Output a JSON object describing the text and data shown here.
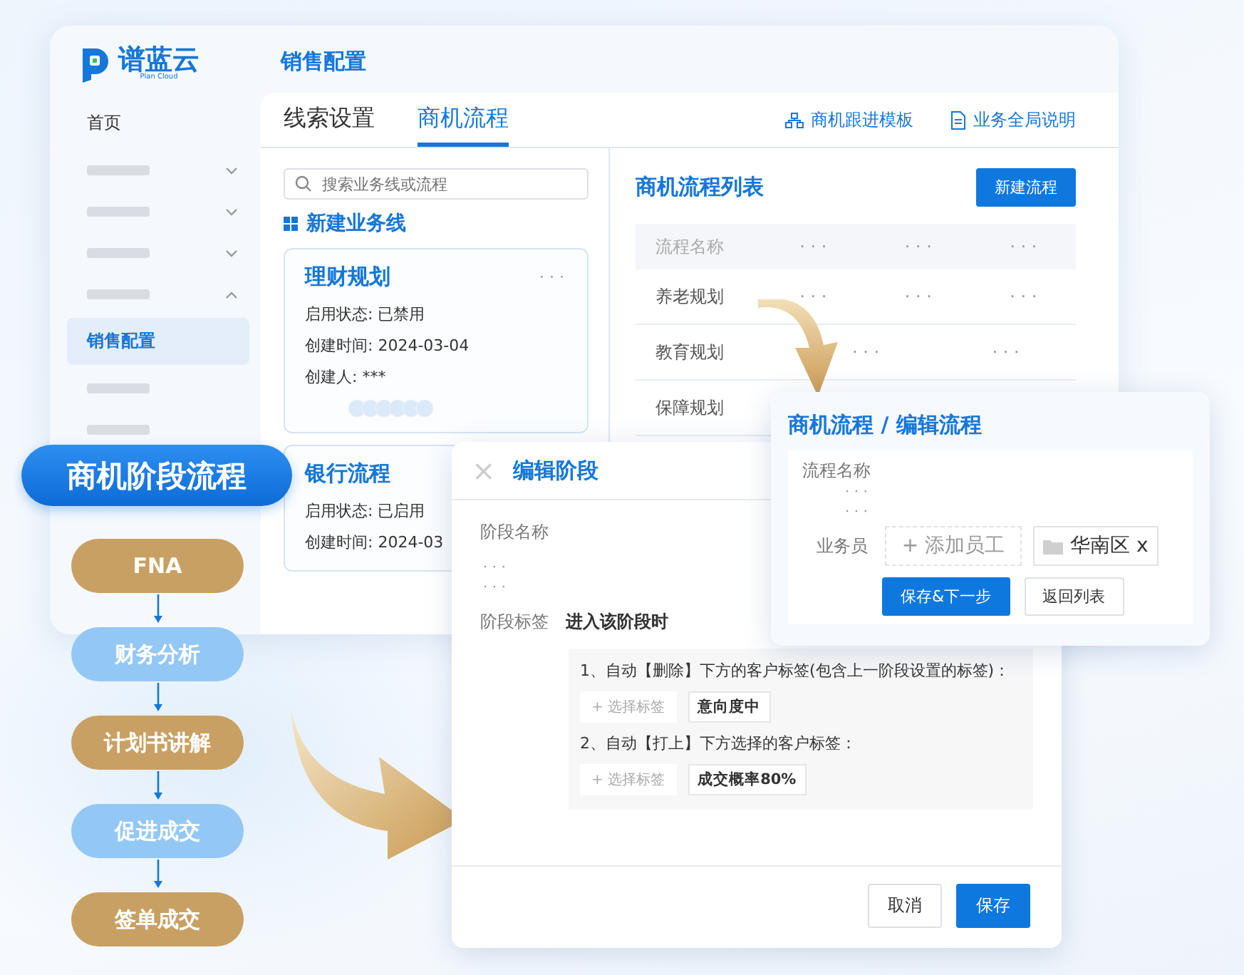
{
  "logo": {
    "name": "谱蓝云",
    "subtitle": "Plan Cloud"
  },
  "sidebar": {
    "items": [
      {
        "kind": "text",
        "label": "首页",
        "selected": false
      },
      {
        "kind": "placeholder",
        "expanded": false
      },
      {
        "kind": "placeholder",
        "expanded": false
      },
      {
        "kind": "placeholder",
        "expanded": false
      },
      {
        "kind": "placeholder",
        "expanded": true
      },
      {
        "kind": "text",
        "label": "销售配置",
        "selected": true
      },
      {
        "kind": "bar"
      },
      {
        "kind": "bar"
      }
    ]
  },
  "page_title": "销售配置",
  "tabs": [
    {
      "label": "线索设置",
      "selected": false
    },
    {
      "label": "商机流程",
      "selected": true
    }
  ],
  "header_links": [
    {
      "kind": "template",
      "label": "商机跟进模板"
    },
    {
      "kind": "doc",
      "label": "业务全局说明"
    }
  ],
  "search": {
    "placeholder": "搜索业务线或流程"
  },
  "new_line": "新建业务线",
  "cards": [
    {
      "title": "理财规划",
      "more": "· · ·",
      "lines": [
        "启用状态: 已禁用",
        "创建时间: 2024-03-04",
        "创建人: ***"
      ],
      "avatars": true
    },
    {
      "title": "银行流程",
      "lines": [
        "启用状态: 已启用",
        "创建时间: 2024-03"
      ],
      "avatars": false
    }
  ],
  "list": {
    "title": "商机流程列表",
    "button": "新建流程",
    "columns": [
      "流程名称",
      "· · ·",
      "· · ·",
      "· · ·"
    ],
    "rows": [
      {
        "cells": [
          "养老规划",
          "· · ·",
          "· · ·",
          "· · ·"
        ]
      },
      {
        "cells": [
          "教育规划",
          "· · ·",
          "· · ·"
        ]
      },
      {
        "cells": [
          "保障规划"
        ]
      }
    ]
  },
  "flow": {
    "title": "商机阶段流程",
    "steps": [
      {
        "label": "FNA",
        "color": "#c9a063"
      },
      {
        "label": "财务分析",
        "color": "#93c8f5"
      },
      {
        "label": "计划书讲解",
        "color": "#c9a063"
      },
      {
        "label": "促进成交",
        "color": "#93c8f5"
      },
      {
        "label": "签单成交",
        "color": "#c9a063"
      }
    ]
  },
  "edit_flow": {
    "title": "商机流程 / 编辑流程",
    "name_label": "流程名称",
    "dots": [
      "· · ·",
      "· · ·"
    ],
    "staff_label": "业务员",
    "add_staff": "+ 添加员工",
    "region": "华南区 x",
    "buttons": [
      {
        "label": "保存&下一步",
        "primary": true
      },
      {
        "label": "返回列表",
        "primary": false
      }
    ]
  },
  "edit_stage": {
    "close": "×",
    "title": "编辑阶段",
    "name_label": "阶段名称",
    "dots": [
      "· · ·",
      "· · ·"
    ],
    "tag_label": "阶段标签",
    "tag_hint": "进入该阶段时",
    "rules": [
      {
        "text": "1、自动【删除】下方的客户标签(包含上一阶段设置的标签)：",
        "select": "+ 选择标签",
        "tag": "意向度中"
      },
      {
        "text": "2、自动【打上】下方选择的客户标签：",
        "select": "+ 选择标签",
        "tag": "成交概率80%"
      }
    ],
    "buttons": [
      {
        "label": "取消",
        "primary": false
      },
      {
        "label": "保存",
        "primary": true
      }
    ]
  }
}
